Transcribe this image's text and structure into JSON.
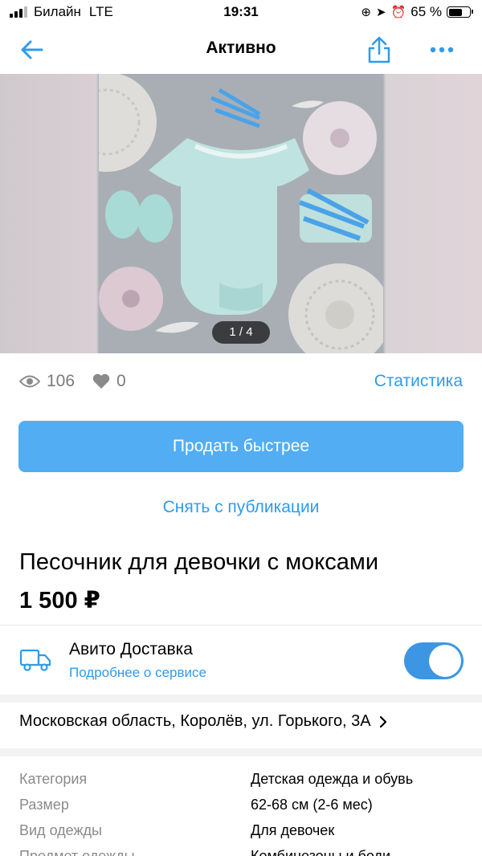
{
  "status_bar": {
    "carrier": "Билайн",
    "network": "LTE",
    "time": "19:31",
    "battery": "65 %",
    "battery_level": 0.65
  },
  "header": {
    "title": "Активно",
    "back_icon": "arrow-left-icon",
    "share_icon": "share-icon",
    "more_icon": "more-dots-icon"
  },
  "gallery": {
    "counter": "1 / 4"
  },
  "stats": {
    "views": "106",
    "likes": "0",
    "link": "Статистика"
  },
  "actions": {
    "sell_faster": "Продать быстрее",
    "unpublish": "Снять с публикации"
  },
  "listing": {
    "title": "Песочник для девочки с моксами",
    "price": "1 500 ₽"
  },
  "delivery": {
    "name": "Авито Доставка",
    "details_link": "Подробнее о сервисе",
    "enabled": true
  },
  "address": "Московская область, Королёв, ул. Горького, 3А",
  "params": [
    {
      "key": "Категория",
      "value": "Детская одежда и обувь"
    },
    {
      "key": "Размер",
      "value": "62-68 см (2-6 мес)"
    },
    {
      "key": "Вид одежды",
      "value": "Для девочек"
    },
    {
      "key": "Предмет одежды",
      "value": "Комбинезоны и боди"
    }
  ],
  "colors": {
    "accent": "#2f9bea",
    "button": "#53adf3",
    "toggle": "#3d96e4"
  }
}
